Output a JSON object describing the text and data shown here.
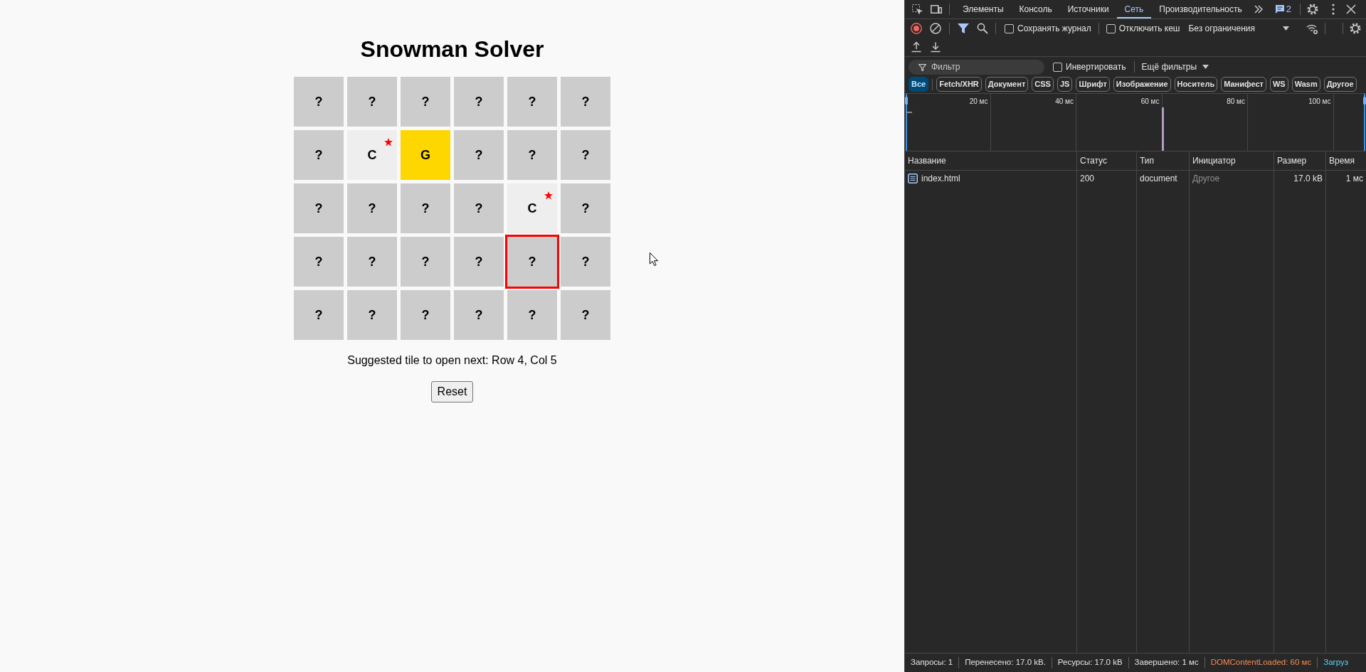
{
  "page": {
    "title": "Snowman Solver",
    "grid": {
      "rows": [
        [
          {
            "label": "?",
            "kind": "closed",
            "starred": false,
            "suggested": false
          },
          {
            "label": "?",
            "kind": "closed",
            "starred": false,
            "suggested": false
          },
          {
            "label": "?",
            "kind": "closed",
            "starred": false,
            "suggested": false
          },
          {
            "label": "?",
            "kind": "closed",
            "starred": false,
            "suggested": false
          },
          {
            "label": "?",
            "kind": "closed",
            "starred": false,
            "suggested": false
          },
          {
            "label": "?",
            "kind": "closed",
            "starred": false,
            "suggested": false
          }
        ],
        [
          {
            "label": "?",
            "kind": "closed",
            "starred": false,
            "suggested": false
          },
          {
            "label": "C",
            "kind": "open",
            "starred": true,
            "suggested": false
          },
          {
            "label": "G",
            "kind": "gold",
            "starred": false,
            "suggested": false
          },
          {
            "label": "?",
            "kind": "closed",
            "starred": false,
            "suggested": false
          },
          {
            "label": "?",
            "kind": "closed",
            "starred": false,
            "suggested": false
          },
          {
            "label": "?",
            "kind": "closed",
            "starred": false,
            "suggested": false
          }
        ],
        [
          {
            "label": "?",
            "kind": "closed",
            "starred": false,
            "suggested": false
          },
          {
            "label": "?",
            "kind": "closed",
            "starred": false,
            "suggested": false
          },
          {
            "label": "?",
            "kind": "closed",
            "starred": false,
            "suggested": false
          },
          {
            "label": "?",
            "kind": "closed",
            "starred": false,
            "suggested": false
          },
          {
            "label": "C",
            "kind": "open",
            "starred": true,
            "suggested": false
          },
          {
            "label": "?",
            "kind": "closed",
            "starred": false,
            "suggested": false
          }
        ],
        [
          {
            "label": "?",
            "kind": "closed",
            "starred": false,
            "suggested": false
          },
          {
            "label": "?",
            "kind": "closed",
            "starred": false,
            "suggested": false
          },
          {
            "label": "?",
            "kind": "closed",
            "starred": false,
            "suggested": false
          },
          {
            "label": "?",
            "kind": "closed",
            "starred": false,
            "suggested": false
          },
          {
            "label": "?",
            "kind": "closed",
            "starred": false,
            "suggested": true
          },
          {
            "label": "?",
            "kind": "closed",
            "starred": false,
            "suggested": false
          }
        ],
        [
          {
            "label": "?",
            "kind": "closed",
            "starred": false,
            "suggested": false
          },
          {
            "label": "?",
            "kind": "closed",
            "starred": false,
            "suggested": false
          },
          {
            "label": "?",
            "kind": "closed",
            "starred": false,
            "suggested": false
          },
          {
            "label": "?",
            "kind": "closed",
            "starred": false,
            "suggested": false
          },
          {
            "label": "?",
            "kind": "closed",
            "starred": false,
            "suggested": false
          },
          {
            "label": "?",
            "kind": "closed",
            "starred": false,
            "suggested": false
          }
        ]
      ]
    },
    "suggestion": "Suggested tile to open next: Row 4, Col 5",
    "reset_button": "Reset"
  },
  "devtools": {
    "tabs": [
      {
        "label": "Элементы",
        "selected": false
      },
      {
        "label": "Консоль",
        "selected": false
      },
      {
        "label": "Источники",
        "selected": false
      },
      {
        "label": "Сеть",
        "selected": true
      },
      {
        "label": "Производительность",
        "selected": false
      }
    ],
    "issues_count": "2",
    "preserve_log": {
      "label": "Сохранять журнал",
      "checked": false
    },
    "disable_cache": {
      "label": "Отключить кеш",
      "checked": false
    },
    "throttling": "Без ограничения",
    "filter": {
      "placeholder": "Фильтр"
    },
    "invert": {
      "label": "Инвертировать",
      "checked": false
    },
    "more_filters": "Ещё фильтры",
    "type_filters": [
      {
        "label": "Все",
        "selected": true
      },
      {
        "label": "Fetch/XHR",
        "selected": false
      },
      {
        "label": "Документ",
        "selected": false
      },
      {
        "label": "CSS",
        "selected": false
      },
      {
        "label": "JS",
        "selected": false
      },
      {
        "label": "Шрифт",
        "selected": false
      },
      {
        "label": "Изображение",
        "selected": false
      },
      {
        "label": "Носитель",
        "selected": false
      },
      {
        "label": "Манифест",
        "selected": false
      },
      {
        "label": "WS",
        "selected": false
      },
      {
        "label": "Wasm",
        "selected": false
      },
      {
        "label": "Другое",
        "selected": false
      }
    ],
    "timeline": {
      "ticks": [
        "20 мс",
        "40 мс",
        "60 мс",
        "80 мс",
        "100 мс"
      ]
    },
    "table": {
      "columns": [
        "Название",
        "Статус",
        "Тип",
        "Инициатор",
        "Размер",
        "Время"
      ],
      "rows": [
        [
          "index.html",
          "200",
          "document",
          "Другое",
          "17.0 kB",
          "1 мс"
        ]
      ]
    },
    "status_bar": [
      {
        "text": "Запросы: 1",
        "kind": "plain"
      },
      {
        "text": "Перенесено: 17.0 kB.",
        "kind": "plain"
      },
      {
        "text": "Ресурсы: 17.0 kB",
        "kind": "plain"
      },
      {
        "text": "Завершено: 1 мс",
        "kind": "plain"
      },
      {
        "text": "DOMContentLoaded: 60 мс",
        "kind": "dom"
      },
      {
        "text": "Загруз",
        "kind": "load"
      }
    ]
  }
}
